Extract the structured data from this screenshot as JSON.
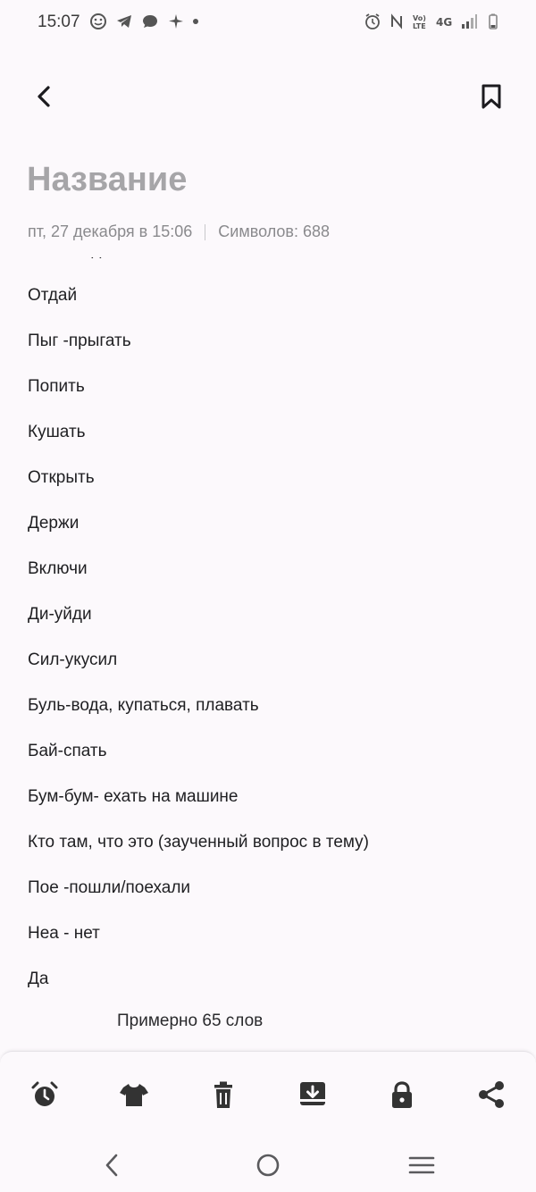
{
  "status_bar": {
    "time": "15:07",
    "left_icons": [
      "emoji-icon",
      "telegram-icon",
      "chat-bubble-icon",
      "plane-icon",
      "dot-icon"
    ],
    "right_icons": [
      "alarm-icon",
      "nfc-icon",
      "volte-icon",
      "4g-icon",
      "signal-icon",
      "battery-icon"
    ],
    "network": "4G",
    "volte": "Vo) LTE"
  },
  "note": {
    "title": "Название",
    "date": "пт, 27 декабря в 15:06",
    "char_count": "Символов: 688",
    "partial_line": "Папа надо",
    "lines": [
      "Отдай",
      "Пыг -прыгать",
      "Попить",
      "Кушать",
      "Открыть",
      "Держи",
      "Включи",
      "Ди-уйди",
      "Сил-укусил",
      "Буль-вода, купаться, плавать",
      "Бай-спать",
      "Бум-бум- ехать на машине",
      "Кто там, что это (заученный вопрос в тему)",
      "Пое -пошли/поехали",
      "Неа - нет",
      "Да"
    ],
    "word_count": "Примерно 65 слов"
  },
  "toolbar": {
    "icons": [
      "alarm-icon",
      "tshirt-icon",
      "trash-icon",
      "download-icon",
      "lock-icon",
      "share-icon"
    ]
  },
  "nav": {
    "icons": [
      "back-icon",
      "home-icon",
      "recents-icon"
    ]
  },
  "colors": {
    "background": "#fcf9fc",
    "title": "#a6a5a8",
    "meta": "#8a8a8d",
    "text": "#1f1f22",
    "icon": "#333333"
  }
}
